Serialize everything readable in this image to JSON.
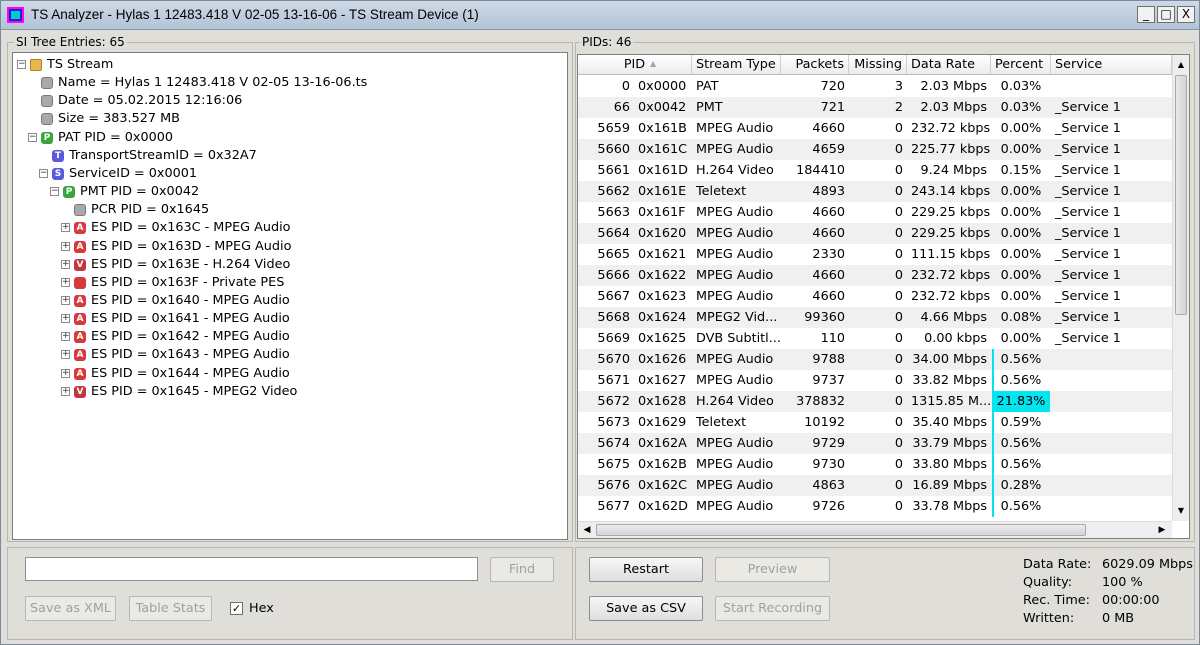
{
  "window": {
    "title": "TS Analyzer - Hylas 1 12483.418 V 02-05 13-16-06 - TS Stream Device (1)",
    "minimize": "_",
    "maximize": "□",
    "close": "X"
  },
  "left": {
    "group_label": "SI Tree Entries: 65",
    "tree": [
      {
        "label": "TS Stream",
        "level": 0,
        "expander": "−",
        "icon": "folder-icon",
        "letter": ""
      },
      {
        "label": "Name = Hylas 1 12483.418 V 02-05 13-16-06.ts",
        "level": 1,
        "expander": "",
        "icon": "gray-node-icon",
        "letter": ""
      },
      {
        "label": "Date = 05.02.2015 12:16:06",
        "level": 1,
        "expander": "",
        "icon": "gray-node-icon",
        "letter": ""
      },
      {
        "label": "Size = 383.527 MB",
        "level": 1,
        "expander": "",
        "icon": "gray-node-icon",
        "letter": ""
      },
      {
        "label": "PAT PID = 0x0000",
        "level": 1,
        "expander": "−",
        "icon": "pat-icon",
        "letter": "P"
      },
      {
        "label": "TransportStreamID = 0x32A7",
        "level": 2,
        "expander": "",
        "icon": "ts-id-icon",
        "letter": "T"
      },
      {
        "label": "ServiceID = 0x0001",
        "level": 2,
        "expander": "−",
        "icon": "service-icon",
        "letter": "S"
      },
      {
        "label": "PMT PID = 0x0042",
        "level": 3,
        "expander": "−",
        "icon": "pmt-icon",
        "letter": "P"
      },
      {
        "label": "PCR PID = 0x1645",
        "level": 4,
        "expander": "",
        "icon": "gray-node-icon",
        "letter": ""
      },
      {
        "label": "ES PID = 0x163C - MPEG Audio",
        "level": 4,
        "expander": "+",
        "icon": "audio-icon",
        "letter": "A"
      },
      {
        "label": "ES PID = 0x163D - MPEG Audio",
        "level": 4,
        "expander": "+",
        "icon": "audio-icon",
        "letter": "A"
      },
      {
        "label": "ES PID = 0x163E - H.264 Video",
        "level": 4,
        "expander": "+",
        "icon": "video-icon",
        "letter": "V"
      },
      {
        "label": "ES PID = 0x163F - Private PES",
        "level": 4,
        "expander": "+",
        "icon": "private-icon",
        "letter": ""
      },
      {
        "label": "ES PID = 0x1640 - MPEG Audio",
        "level": 4,
        "expander": "+",
        "icon": "audio-icon",
        "letter": "A"
      },
      {
        "label": "ES PID = 0x1641 - MPEG Audio",
        "level": 4,
        "expander": "+",
        "icon": "audio-icon",
        "letter": "A"
      },
      {
        "label": "ES PID = 0x1642 - MPEG Audio",
        "level": 4,
        "expander": "+",
        "icon": "audio-icon",
        "letter": "A"
      },
      {
        "label": "ES PID = 0x1643 - MPEG Audio",
        "level": 4,
        "expander": "+",
        "icon": "audio-icon",
        "letter": "A"
      },
      {
        "label": "ES PID = 0x1644 - MPEG Audio",
        "level": 4,
        "expander": "+",
        "icon": "audio-icon",
        "letter": "A"
      },
      {
        "label": "ES PID = 0x1645 - MPEG2 Video",
        "level": 4,
        "expander": "+",
        "icon": "video-icon",
        "letter": "V"
      }
    ],
    "search_value": "",
    "find_label": "Find",
    "save_xml_label": "Save as XML",
    "table_stats_label": "Table Stats",
    "hex_label": "Hex",
    "hex_checked": "✓"
  },
  "right": {
    "group_label": "PIDs: 46",
    "columns": [
      "PID",
      "Stream Type",
      "Packets",
      "Missing",
      "Data Rate",
      "Percent",
      "Service"
    ],
    "sort_indicator": "▲",
    "rows": [
      {
        "pid": "0",
        "hex": "0x0000",
        "type": "PAT",
        "packets": "720",
        "missing": "3",
        "rate": "2.03 Mbps",
        "percent": "0.03%",
        "service": "",
        "bar": 0
      },
      {
        "pid": "66",
        "hex": "0x0042",
        "type": "PMT",
        "packets": "721",
        "missing": "2",
        "rate": "2.03 Mbps",
        "percent": "0.03%",
        "service": "_Service 1",
        "bar": 0
      },
      {
        "pid": "5659",
        "hex": "0x161B",
        "type": "MPEG Audio",
        "packets": "4660",
        "missing": "0",
        "rate": "232.72 kbps",
        "percent": "0.00%",
        "service": "_Service 1",
        "bar": 0
      },
      {
        "pid": "5660",
        "hex": "0x161C",
        "type": "MPEG Audio",
        "packets": "4659",
        "missing": "0",
        "rate": "225.77 kbps",
        "percent": "0.00%",
        "service": "_Service 1",
        "bar": 0
      },
      {
        "pid": "5661",
        "hex": "0x161D",
        "type": "H.264 Video",
        "packets": "184410",
        "missing": "0",
        "rate": "9.24 Mbps",
        "percent": "0.15%",
        "service": "_Service 1",
        "bar": 0
      },
      {
        "pid": "5662",
        "hex": "0x161E",
        "type": "Teletext",
        "packets": "4893",
        "missing": "0",
        "rate": "243.14 kbps",
        "percent": "0.00%",
        "service": "_Service 1",
        "bar": 0
      },
      {
        "pid": "5663",
        "hex": "0x161F",
        "type": "MPEG Audio",
        "packets": "4660",
        "missing": "0",
        "rate": "229.25 kbps",
        "percent": "0.00%",
        "service": "_Service 1",
        "bar": 0
      },
      {
        "pid": "5664",
        "hex": "0x1620",
        "type": "MPEG Audio",
        "packets": "4660",
        "missing": "0",
        "rate": "229.25 kbps",
        "percent": "0.00%",
        "service": "_Service 1",
        "bar": 0
      },
      {
        "pid": "5665",
        "hex": "0x1621",
        "type": "MPEG Audio",
        "packets": "2330",
        "missing": "0",
        "rate": "111.15 kbps",
        "percent": "0.00%",
        "service": "_Service 1",
        "bar": 0
      },
      {
        "pid": "5666",
        "hex": "0x1622",
        "type": "MPEG Audio",
        "packets": "4660",
        "missing": "0",
        "rate": "232.72 kbps",
        "percent": "0.00%",
        "service": "_Service 1",
        "bar": 0
      },
      {
        "pid": "5667",
        "hex": "0x1623",
        "type": "MPEG Audio",
        "packets": "4660",
        "missing": "0",
        "rate": "232.72 kbps",
        "percent": "0.00%",
        "service": "_Service 1",
        "bar": 0
      },
      {
        "pid": "5668",
        "hex": "0x1624",
        "type": "MPEG2 Vid...",
        "packets": "99360",
        "missing": "0",
        "rate": "4.66 Mbps",
        "percent": "0.08%",
        "service": "_Service 1",
        "bar": 0
      },
      {
        "pid": "5669",
        "hex": "0x1625",
        "type": "DVB Subtitl...",
        "packets": "110",
        "missing": "0",
        "rate": "0.00 kbps",
        "percent": "0.00%",
        "service": "_Service 1",
        "bar": 0
      },
      {
        "pid": "5670",
        "hex": "0x1626",
        "type": "MPEG Audio",
        "packets": "9788",
        "missing": "0",
        "rate": "34.00 Mbps",
        "percent": "0.56%",
        "service": "",
        "bar": 0.56
      },
      {
        "pid": "5671",
        "hex": "0x1627",
        "type": "MPEG Audio",
        "packets": "9737",
        "missing": "0",
        "rate": "33.82 Mbps",
        "percent": "0.56%",
        "service": "",
        "bar": 0.56
      },
      {
        "pid": "5672",
        "hex": "0x1628",
        "type": "H.264 Video",
        "packets": "378832",
        "missing": "0",
        "rate": "1315.85 M...",
        "percent": "21.83%",
        "service": "",
        "bar": 21.83
      },
      {
        "pid": "5673",
        "hex": "0x1629",
        "type": "Teletext",
        "packets": "10192",
        "missing": "0",
        "rate": "35.40 Mbps",
        "percent": "0.59%",
        "service": "",
        "bar": 0.59
      },
      {
        "pid": "5674",
        "hex": "0x162A",
        "type": "MPEG Audio",
        "packets": "9729",
        "missing": "0",
        "rate": "33.79 Mbps",
        "percent": "0.56%",
        "service": "",
        "bar": 0.56
      },
      {
        "pid": "5675",
        "hex": "0x162B",
        "type": "MPEG Audio",
        "packets": "9730",
        "missing": "0",
        "rate": "33.80 Mbps",
        "percent": "0.56%",
        "service": "",
        "bar": 0.56
      },
      {
        "pid": "5676",
        "hex": "0x162C",
        "type": "MPEG Audio",
        "packets": "4863",
        "missing": "0",
        "rate": "16.89 Mbps",
        "percent": "0.28%",
        "service": "",
        "bar": 0.28
      },
      {
        "pid": "5677",
        "hex": "0x162D",
        "type": "MPEG Audio",
        "packets": "9726",
        "missing": "0",
        "rate": "33.78 Mbps",
        "percent": "0.56%",
        "service": "",
        "bar": 0.56
      }
    ],
    "restart_label": "Restart",
    "preview_label": "Preview",
    "save_csv_label": "Save as CSV",
    "start_recording_label": "Start Recording",
    "stats": {
      "rate_label": "Data Rate:",
      "rate_value": "6029.09 Mbps",
      "quality_label": "Quality:",
      "quality_value": "100 %",
      "rec_label": "Rec. Time:",
      "rec_value": "00:00:00",
      "written_label": "Written:",
      "written_value": "0 MB"
    }
  },
  "colors": {
    "accent_bar": "#00e5f0",
    "audio_icon": "#d63a3a",
    "video_icon": "#c8343c",
    "pat_icon": "#3aa53a",
    "service_icon": "#5a5adf",
    "folder_icon": "#e8b84a"
  }
}
